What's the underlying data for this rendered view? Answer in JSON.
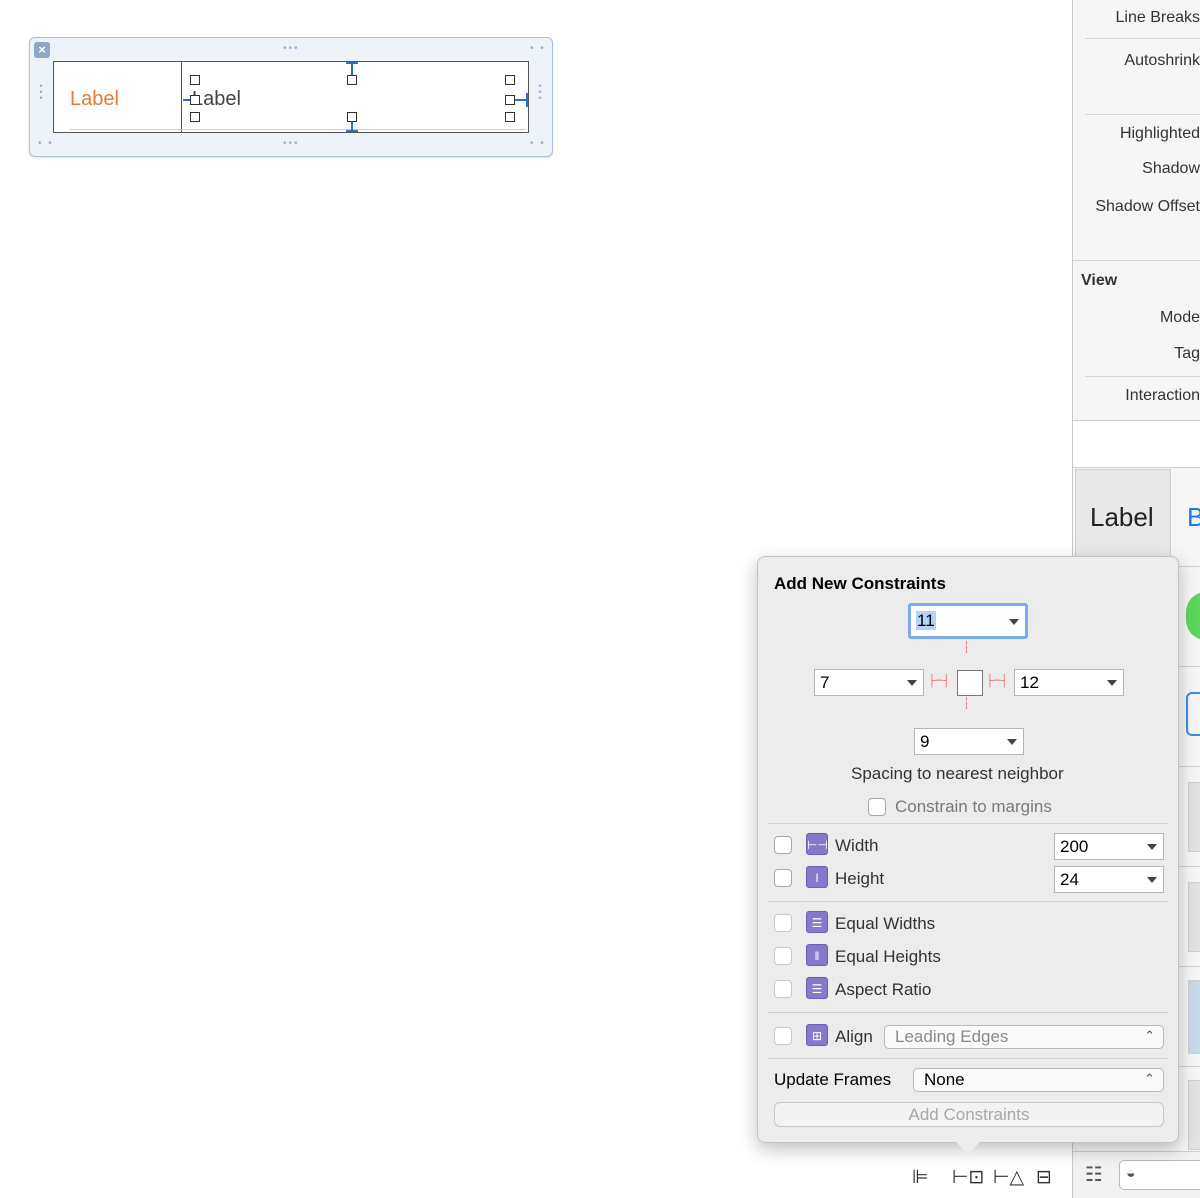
{
  "scene": {
    "label_left": "Label",
    "label_right": "Label"
  },
  "inspector": {
    "rows": {
      "line_breaks": "Line Breaks",
      "autoshrink": "Autoshrink",
      "highlighted": "Highlighted",
      "shadow": "Shadow",
      "shadow_offset": "Shadow Offset",
      "mode": "Mode",
      "tag": "Tag",
      "interaction": "Interaction"
    },
    "section_view": "View",
    "library_label": "Label",
    "library_b": "B"
  },
  "popover": {
    "title": "Add New Constraints",
    "top_value": "11",
    "left_value": "7",
    "right_value": "12",
    "bottom_value": "9",
    "spacing_caption": "Spacing to nearest neighbor",
    "constrain_margins": "Constrain to margins",
    "width_label": "Width",
    "width_value": "200",
    "height_label": "Height",
    "height_value": "24",
    "equal_widths": "Equal Widths",
    "equal_heights": "Equal Heights",
    "aspect_ratio": "Aspect Ratio",
    "align_label": "Align",
    "align_value": "Leading Edges",
    "update_frames_label": "Update Frames",
    "update_frames_value": "None",
    "add_button": "Add Constraints"
  },
  "icons": {
    "toolbar": [
      "align-icon",
      "pin-icon",
      "resolve-issues-icon",
      "resizing-icon"
    ],
    "bottom": [
      "outline-toggle-icon",
      "filter-icon"
    ]
  }
}
